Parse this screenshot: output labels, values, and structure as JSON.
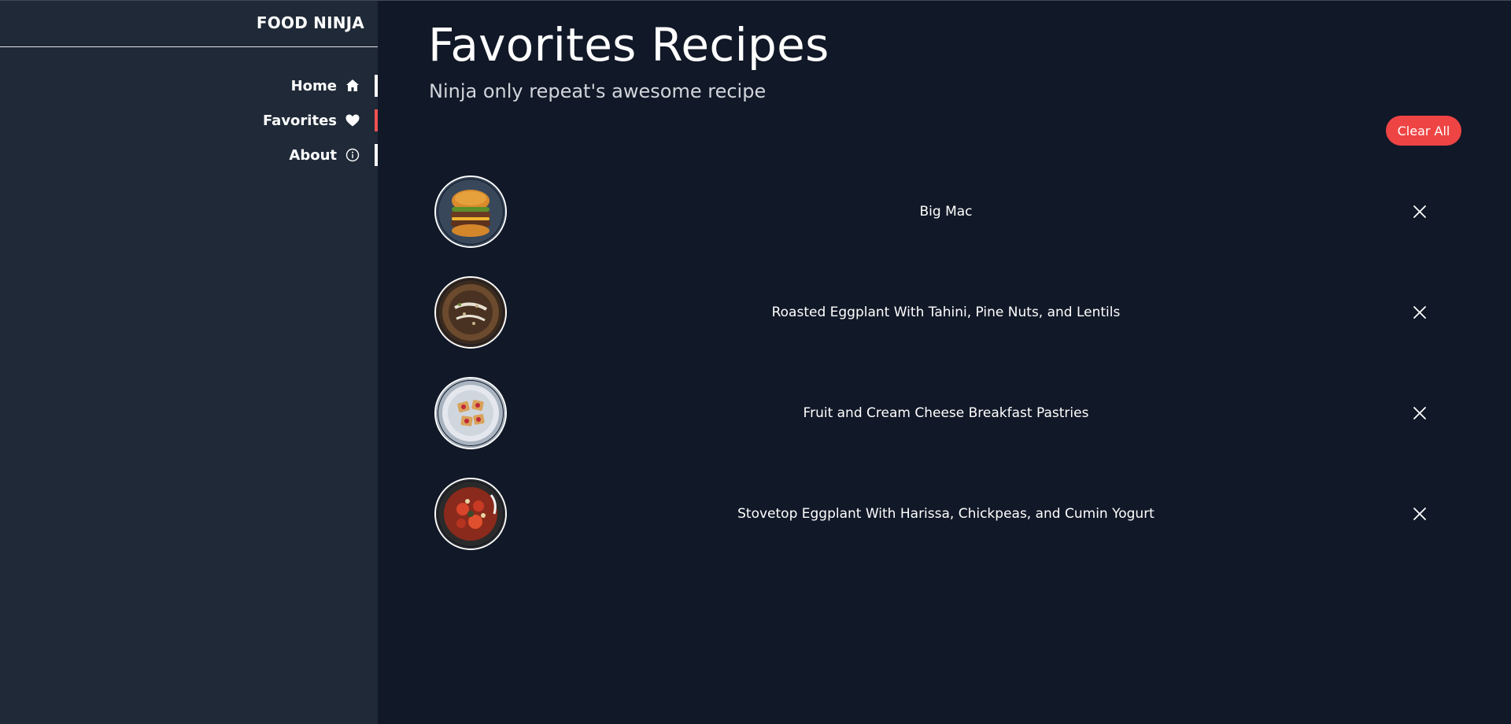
{
  "sidebar": {
    "brand": "FOOD NINJA",
    "items": [
      {
        "label": "Home",
        "icon": "home-icon",
        "active": false
      },
      {
        "label": "Favorites",
        "icon": "heart-icon",
        "active": true
      },
      {
        "label": "About",
        "icon": "info-icon",
        "active": false
      }
    ]
  },
  "main": {
    "title": "Favorites Recipes",
    "subtitle": "Ninja only repeat's awesome recipe",
    "clear_all_label": "Clear All",
    "favorites": [
      {
        "name": "Big Mac",
        "image": "burger-image"
      },
      {
        "name": "Roasted Eggplant With Tahini, Pine Nuts, and Lentils",
        "image": "eggplant-tahini-image"
      },
      {
        "name": "Fruit and Cream Cheese Breakfast Pastries",
        "image": "pastries-image"
      },
      {
        "name": "Stovetop Eggplant With Harissa, Chickpeas, and Cumin Yogurt",
        "image": "eggplant-harissa-image"
      }
    ]
  },
  "colors": {
    "sidebar_bg": "#1f2937",
    "main_bg": "#111827",
    "accent": "#ef4444",
    "active_indicator": "#f05252"
  }
}
